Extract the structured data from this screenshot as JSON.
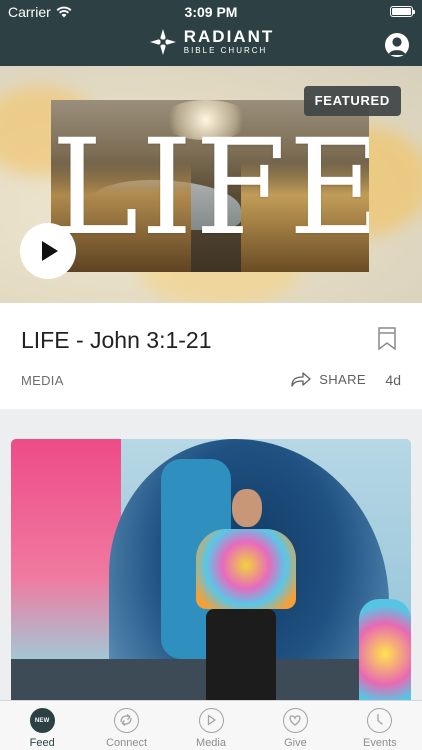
{
  "status_bar": {
    "carrier": "Carrier",
    "time": "3:09 PM"
  },
  "header": {
    "brand_line1": "RADIANT",
    "brand_line2": "BIBLE CHURCH",
    "profile_icon": "user-avatar-icon"
  },
  "featured_card": {
    "badge": "FEATURED",
    "artwork_word": "LIFE",
    "title": "LIFE - John 3:1-21",
    "category": "MEDIA",
    "share_label": "SHARE",
    "age": "4d"
  },
  "tabs": [
    {
      "label": "Feed",
      "badge": "NEW",
      "icon": "feed-icon",
      "active": true
    },
    {
      "label": "Connect",
      "icon": "connect-arrows-icon"
    },
    {
      "label": "Media",
      "icon": "play-circle-icon"
    },
    {
      "label": "Give",
      "icon": "heart-icon"
    },
    {
      "label": "Events",
      "icon": "clock-icon"
    }
  ],
  "colors": {
    "header_bg": "#2d4144",
    "accent": "#2d4144",
    "tab_inactive": "#8e8e8e"
  }
}
